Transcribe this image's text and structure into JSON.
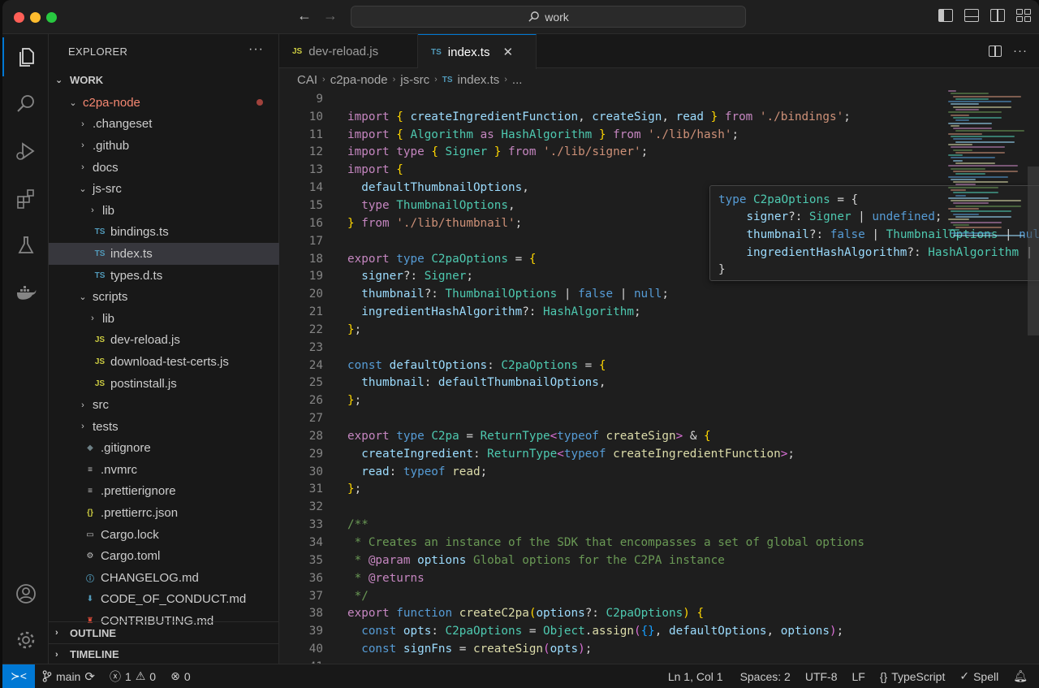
{
  "titlebar": {
    "search_text": "work",
    "back_icon": "arrow-left-icon",
    "forward_icon": "arrow-right-icon"
  },
  "activity_bar": {
    "items": [
      "explorer-icon",
      "search-icon",
      "run-debug-icon",
      "extensions-icon",
      "testing-icon",
      "docker-icon"
    ],
    "bottom": [
      "accounts-icon",
      "settings-gear-icon"
    ]
  },
  "sidebar": {
    "title": "EXPLORER",
    "more": "···",
    "section": "WORK",
    "tree": [
      {
        "indent": 1,
        "chevron": "⌄",
        "icon": "",
        "name": "c2pa-node",
        "modified": true
      },
      {
        "indent": 2,
        "chevron": "›",
        "icon": "",
        "name": ".changeset"
      },
      {
        "indent": 2,
        "chevron": "›",
        "icon": "",
        "name": ".github"
      },
      {
        "indent": 2,
        "chevron": "›",
        "icon": "",
        "name": "docs"
      },
      {
        "indent": 2,
        "chevron": "⌄",
        "icon": "",
        "name": "js-src"
      },
      {
        "indent": 3,
        "chevron": "›",
        "icon": "",
        "name": "lib"
      },
      {
        "indent": 3,
        "chevron": "",
        "icon": "TS",
        "name": "bindings.ts"
      },
      {
        "indent": 3,
        "chevron": "",
        "icon": "TS",
        "name": "index.ts",
        "selected": true
      },
      {
        "indent": 3,
        "chevron": "",
        "icon": "TS",
        "name": "types.d.ts"
      },
      {
        "indent": 2,
        "chevron": "⌄",
        "icon": "",
        "name": "scripts"
      },
      {
        "indent": 3,
        "chevron": "›",
        "icon": "",
        "name": "lib"
      },
      {
        "indent": 3,
        "chevron": "",
        "icon": "JS",
        "name": "dev-reload.js"
      },
      {
        "indent": 3,
        "chevron": "",
        "icon": "JS",
        "name": "download-test-certs.js"
      },
      {
        "indent": 3,
        "chevron": "",
        "icon": "JS",
        "name": "postinstall.js"
      },
      {
        "indent": 2,
        "chevron": "›",
        "icon": "",
        "name": "src"
      },
      {
        "indent": 2,
        "chevron": "›",
        "icon": "",
        "name": "tests"
      },
      {
        "indent": 2,
        "chevron": "",
        "icon": "◆",
        "name": ".gitignore"
      },
      {
        "indent": 2,
        "chevron": "",
        "icon": "≡",
        "name": ".nvmrc"
      },
      {
        "indent": 2,
        "chevron": "",
        "icon": "≡",
        "name": ".prettierignore"
      },
      {
        "indent": 2,
        "chevron": "",
        "icon": "{}",
        "name": ".prettierrc.json"
      },
      {
        "indent": 2,
        "chevron": "",
        "icon": "▭",
        "name": "Cargo.lock"
      },
      {
        "indent": 2,
        "chevron": "",
        "icon": "⚙",
        "name": "Cargo.toml"
      },
      {
        "indent": 2,
        "chevron": "",
        "icon": "ⓘ",
        "name": "CHANGELOG.md"
      },
      {
        "indent": 2,
        "chevron": "",
        "icon": "⬇",
        "name": "CODE_OF_CONDUCT.md"
      },
      {
        "indent": 2,
        "chevron": "",
        "icon": "♜",
        "name": "CONTRIBUTING.md"
      }
    ],
    "outline": "OUTLINE",
    "timeline": "TIMELINE"
  },
  "tabs": [
    {
      "icon": "JS",
      "label": "dev-reload.js",
      "active": false
    },
    {
      "icon": "TS",
      "label": "index.ts",
      "active": true
    }
  ],
  "breadcrumb": [
    "CAI",
    "c2pa-node",
    "js-src",
    "index.ts",
    "..."
  ],
  "code_lines": [
    {
      "n": "9",
      "tokens": []
    },
    {
      "n": "10",
      "tokens": [
        [
          "k",
          "import"
        ],
        [
          "pn",
          " "
        ],
        [
          "br1",
          "{"
        ],
        [
          "pn",
          " "
        ],
        [
          "v",
          "createIngredientFunction"
        ],
        [
          "pn",
          ", "
        ],
        [
          "v",
          "createSign"
        ],
        [
          "pn",
          ", "
        ],
        [
          "v",
          "read"
        ],
        [
          "pn",
          " "
        ],
        [
          "br1",
          "}"
        ],
        [
          "pn",
          " "
        ],
        [
          "k",
          "from"
        ],
        [
          "pn",
          " "
        ],
        [
          "s",
          "'./bindings'"
        ],
        [
          "pn",
          ";"
        ]
      ]
    },
    {
      "n": "11",
      "tokens": [
        [
          "k",
          "import"
        ],
        [
          "pn",
          " "
        ],
        [
          "br1",
          "{"
        ],
        [
          "pn",
          " "
        ],
        [
          "t",
          "Algorithm"
        ],
        [
          "pn",
          " "
        ],
        [
          "k",
          "as"
        ],
        [
          "pn",
          " "
        ],
        [
          "t",
          "HashAlgorithm"
        ],
        [
          "pn",
          " "
        ],
        [
          "br1",
          "}"
        ],
        [
          "pn",
          " "
        ],
        [
          "k",
          "from"
        ],
        [
          "pn",
          " "
        ],
        [
          "s",
          "'./lib/hash'"
        ],
        [
          "pn",
          ";"
        ]
      ]
    },
    {
      "n": "12",
      "tokens": [
        [
          "k",
          "import"
        ],
        [
          "pn",
          " "
        ],
        [
          "k",
          "type"
        ],
        [
          "pn",
          " "
        ],
        [
          "br1",
          "{"
        ],
        [
          "pn",
          " "
        ],
        [
          "t",
          "Signer"
        ],
        [
          "pn",
          " "
        ],
        [
          "br1",
          "}"
        ],
        [
          "pn",
          " "
        ],
        [
          "k",
          "from"
        ],
        [
          "pn",
          " "
        ],
        [
          "s",
          "'./lib/signer'"
        ],
        [
          "pn",
          ";"
        ]
      ]
    },
    {
      "n": "13",
      "tokens": [
        [
          "k",
          "import"
        ],
        [
          "pn",
          " "
        ],
        [
          "br1",
          "{"
        ]
      ]
    },
    {
      "n": "14",
      "tokens": [
        [
          "pn",
          "  "
        ],
        [
          "v",
          "defaultThumbnailOptions"
        ],
        [
          "pn",
          ","
        ]
      ]
    },
    {
      "n": "15",
      "tokens": [
        [
          "pn",
          "  "
        ],
        [
          "k",
          "type"
        ],
        [
          "pn",
          " "
        ],
        [
          "t",
          "ThumbnailOptions"
        ],
        [
          "pn",
          ","
        ]
      ]
    },
    {
      "n": "16",
      "tokens": [
        [
          "br1",
          "}"
        ],
        [
          "pn",
          " "
        ],
        [
          "k",
          "from"
        ],
        [
          "pn",
          " "
        ],
        [
          "s",
          "'./lib/thumbnail'"
        ],
        [
          "pn",
          ";"
        ]
      ]
    },
    {
      "n": "17",
      "tokens": []
    },
    {
      "n": "18",
      "tokens": [
        [
          "k",
          "export"
        ],
        [
          "pn",
          " "
        ],
        [
          "kb",
          "type"
        ],
        [
          "pn",
          " "
        ],
        [
          "t",
          "C2paOptions"
        ],
        [
          "pn",
          " = "
        ],
        [
          "br1",
          "{"
        ]
      ]
    },
    {
      "n": "19",
      "tokens": [
        [
          "pn",
          "  "
        ],
        [
          "v",
          "signer"
        ],
        [
          "pn",
          "?: "
        ],
        [
          "t",
          "Signer"
        ],
        [
          "pn",
          ";"
        ]
      ]
    },
    {
      "n": "20",
      "tokens": [
        [
          "pn",
          "  "
        ],
        [
          "v",
          "thumbnail"
        ],
        [
          "pn",
          "?: "
        ],
        [
          "t",
          "ThumbnailOptions"
        ],
        [
          "pn",
          " | "
        ],
        [
          "kb",
          "false"
        ],
        [
          "pn",
          " | "
        ],
        [
          "kb",
          "null"
        ],
        [
          "pn",
          ";"
        ]
      ]
    },
    {
      "n": "21",
      "tokens": [
        [
          "pn",
          "  "
        ],
        [
          "v",
          "ingredientHashAlgorithm"
        ],
        [
          "pn",
          "?: "
        ],
        [
          "t",
          "HashAlgorithm"
        ],
        [
          "pn",
          ";"
        ]
      ]
    },
    {
      "n": "22",
      "tokens": [
        [
          "br1",
          "}"
        ],
        [
          "pn",
          ";"
        ]
      ]
    },
    {
      "n": "23",
      "tokens": []
    },
    {
      "n": "24",
      "tokens": [
        [
          "kb",
          "const"
        ],
        [
          "pn",
          " "
        ],
        [
          "v",
          "defaultOptions"
        ],
        [
          "pn",
          ": "
        ],
        [
          "t",
          "C2paOptions"
        ],
        [
          "pn",
          " = "
        ],
        [
          "br1",
          "{"
        ]
      ]
    },
    {
      "n": "25",
      "tokens": [
        [
          "pn",
          "  "
        ],
        [
          "v",
          "thumbnail"
        ],
        [
          "pn",
          ": "
        ],
        [
          "v",
          "defaultThumbnailOptions"
        ],
        [
          "pn",
          ","
        ]
      ]
    },
    {
      "n": "26",
      "tokens": [
        [
          "br1",
          "}"
        ],
        [
          "pn",
          ";"
        ]
      ]
    },
    {
      "n": "27",
      "tokens": []
    },
    {
      "n": "28",
      "tokens": [
        [
          "k",
          "export"
        ],
        [
          "pn",
          " "
        ],
        [
          "kb",
          "type"
        ],
        [
          "pn",
          " "
        ],
        [
          "t",
          "C2pa"
        ],
        [
          "pn",
          " = "
        ],
        [
          "t",
          "ReturnType"
        ],
        [
          "br2",
          "<"
        ],
        [
          "kb",
          "typeof"
        ],
        [
          "pn",
          " "
        ],
        [
          "f",
          "createSign"
        ],
        [
          "br2",
          ">"
        ],
        [
          "pn",
          " & "
        ],
        [
          "br1",
          "{"
        ]
      ]
    },
    {
      "n": "29",
      "tokens": [
        [
          "pn",
          "  "
        ],
        [
          "v",
          "createIngredient"
        ],
        [
          "pn",
          ": "
        ],
        [
          "t",
          "ReturnType"
        ],
        [
          "br2",
          "<"
        ],
        [
          "kb",
          "typeof"
        ],
        [
          "pn",
          " "
        ],
        [
          "f",
          "createIngredientFunction"
        ],
        [
          "br2",
          ">"
        ],
        [
          "pn",
          ";"
        ]
      ]
    },
    {
      "n": "30",
      "tokens": [
        [
          "pn",
          "  "
        ],
        [
          "v",
          "read"
        ],
        [
          "pn",
          ": "
        ],
        [
          "kb",
          "typeof"
        ],
        [
          "pn",
          " "
        ],
        [
          "f",
          "read"
        ],
        [
          "pn",
          ";"
        ]
      ]
    },
    {
      "n": "31",
      "tokens": [
        [
          "br1",
          "}"
        ],
        [
          "pn",
          ";"
        ]
      ]
    },
    {
      "n": "32",
      "tokens": []
    },
    {
      "n": "33",
      "tokens": [
        [
          "cb",
          "/**"
        ]
      ]
    },
    {
      "n": "34",
      "tokens": [
        [
          "cb",
          " * Creates an instance of the SDK that encompasses a set of global options"
        ]
      ]
    },
    {
      "n": "35",
      "tokens": [
        [
          "cb",
          " * "
        ],
        [
          "k",
          "@param"
        ],
        [
          "pn",
          " "
        ],
        [
          "v",
          "options"
        ],
        [
          "cb",
          " Global options for the C2PA instance"
        ]
      ]
    },
    {
      "n": "36",
      "tokens": [
        [
          "cb",
          " * "
        ],
        [
          "k",
          "@returns"
        ]
      ]
    },
    {
      "n": "37",
      "tokens": [
        [
          "cb",
          " */"
        ]
      ]
    },
    {
      "n": "38",
      "tokens": [
        [
          "k",
          "export"
        ],
        [
          "pn",
          " "
        ],
        [
          "kb",
          "function"
        ],
        [
          "pn",
          " "
        ],
        [
          "f",
          "createC2pa"
        ],
        [
          "br1",
          "("
        ],
        [
          "v",
          "options"
        ],
        [
          "pn",
          "?: "
        ],
        [
          "t",
          "C2paOptions"
        ],
        [
          "br1",
          ")"
        ],
        [
          "pn",
          " "
        ],
        [
          "br1",
          "{"
        ]
      ]
    },
    {
      "n": "39",
      "tokens": [
        [
          "pn",
          "  "
        ],
        [
          "kb",
          "const"
        ],
        [
          "pn",
          " "
        ],
        [
          "v",
          "opts"
        ],
        [
          "pn",
          ": "
        ],
        [
          "t",
          "C2paOptions"
        ],
        [
          "pn",
          " = "
        ],
        [
          "t",
          "Object"
        ],
        [
          "pn",
          "."
        ],
        [
          "f",
          "assign"
        ],
        [
          "br2",
          "("
        ],
        [
          "br3",
          "{}"
        ],
        [
          "pn",
          ", "
        ],
        [
          "v",
          "defaultOptions"
        ],
        [
          "pn",
          ", "
        ],
        [
          "v",
          "options"
        ],
        [
          "br2",
          ")"
        ],
        [
          "pn",
          ";"
        ]
      ]
    },
    {
      "n": "40",
      "tokens": [
        [
          "pn",
          "  "
        ],
        [
          "kb",
          "const"
        ],
        [
          "pn",
          " "
        ],
        [
          "v",
          "signFns"
        ],
        [
          "pn",
          " = "
        ],
        [
          "f",
          "createSign"
        ],
        [
          "br2",
          "("
        ],
        [
          "v",
          "opts"
        ],
        [
          "br2",
          ")"
        ],
        [
          "pn",
          ";"
        ]
      ]
    },
    {
      "n": "41",
      "tokens": []
    }
  ],
  "hover_lines": [
    [
      [
        "kb",
        "type"
      ],
      [
        "pn",
        " "
      ],
      [
        "t",
        "C2paOptions"
      ],
      [
        "pn",
        " = {"
      ]
    ],
    [
      [
        "pn",
        "    "
      ],
      [
        "v",
        "signer"
      ],
      [
        "pn",
        "?: "
      ],
      [
        "t",
        "Signer"
      ],
      [
        "pn",
        " | "
      ],
      [
        "kb",
        "undefined"
      ],
      [
        "pn",
        ";"
      ]
    ],
    [
      [
        "pn",
        "    "
      ],
      [
        "v",
        "thumbnail"
      ],
      [
        "pn",
        "?: "
      ],
      [
        "kb",
        "false"
      ],
      [
        "pn",
        " | "
      ],
      [
        "t",
        "ThumbnailOptions"
      ],
      [
        "pn",
        " | "
      ],
      [
        "kb",
        "null"
      ],
      [
        "pn",
        " | "
      ],
      [
        "kb",
        "undefined"
      ],
      [
        "pn",
        ";"
      ]
    ],
    [
      [
        "pn",
        "    "
      ],
      [
        "v",
        "ingredientHashAlgorithm"
      ],
      [
        "pn",
        "?: "
      ],
      [
        "t",
        "HashAlgorithm"
      ],
      [
        "pn",
        " | "
      ],
      [
        "kb",
        "undefined"
      ],
      [
        "pn",
        ";"
      ]
    ],
    [
      [
        "pn",
        "}"
      ]
    ]
  ],
  "statusbar": {
    "branch": "main",
    "errors": "1",
    "warnings": "0",
    "ports": "0",
    "position": "Ln 1, Col 1",
    "spaces": "Spaces: 2",
    "encoding": "UTF-8",
    "eol": "LF",
    "language": "TypeScript",
    "spell": "Spell"
  },
  "colors": {
    "accent": "#0078d4",
    "ts_icon": "#519aba",
    "js_icon": "#cbcb41",
    "modified": "#f48771"
  }
}
